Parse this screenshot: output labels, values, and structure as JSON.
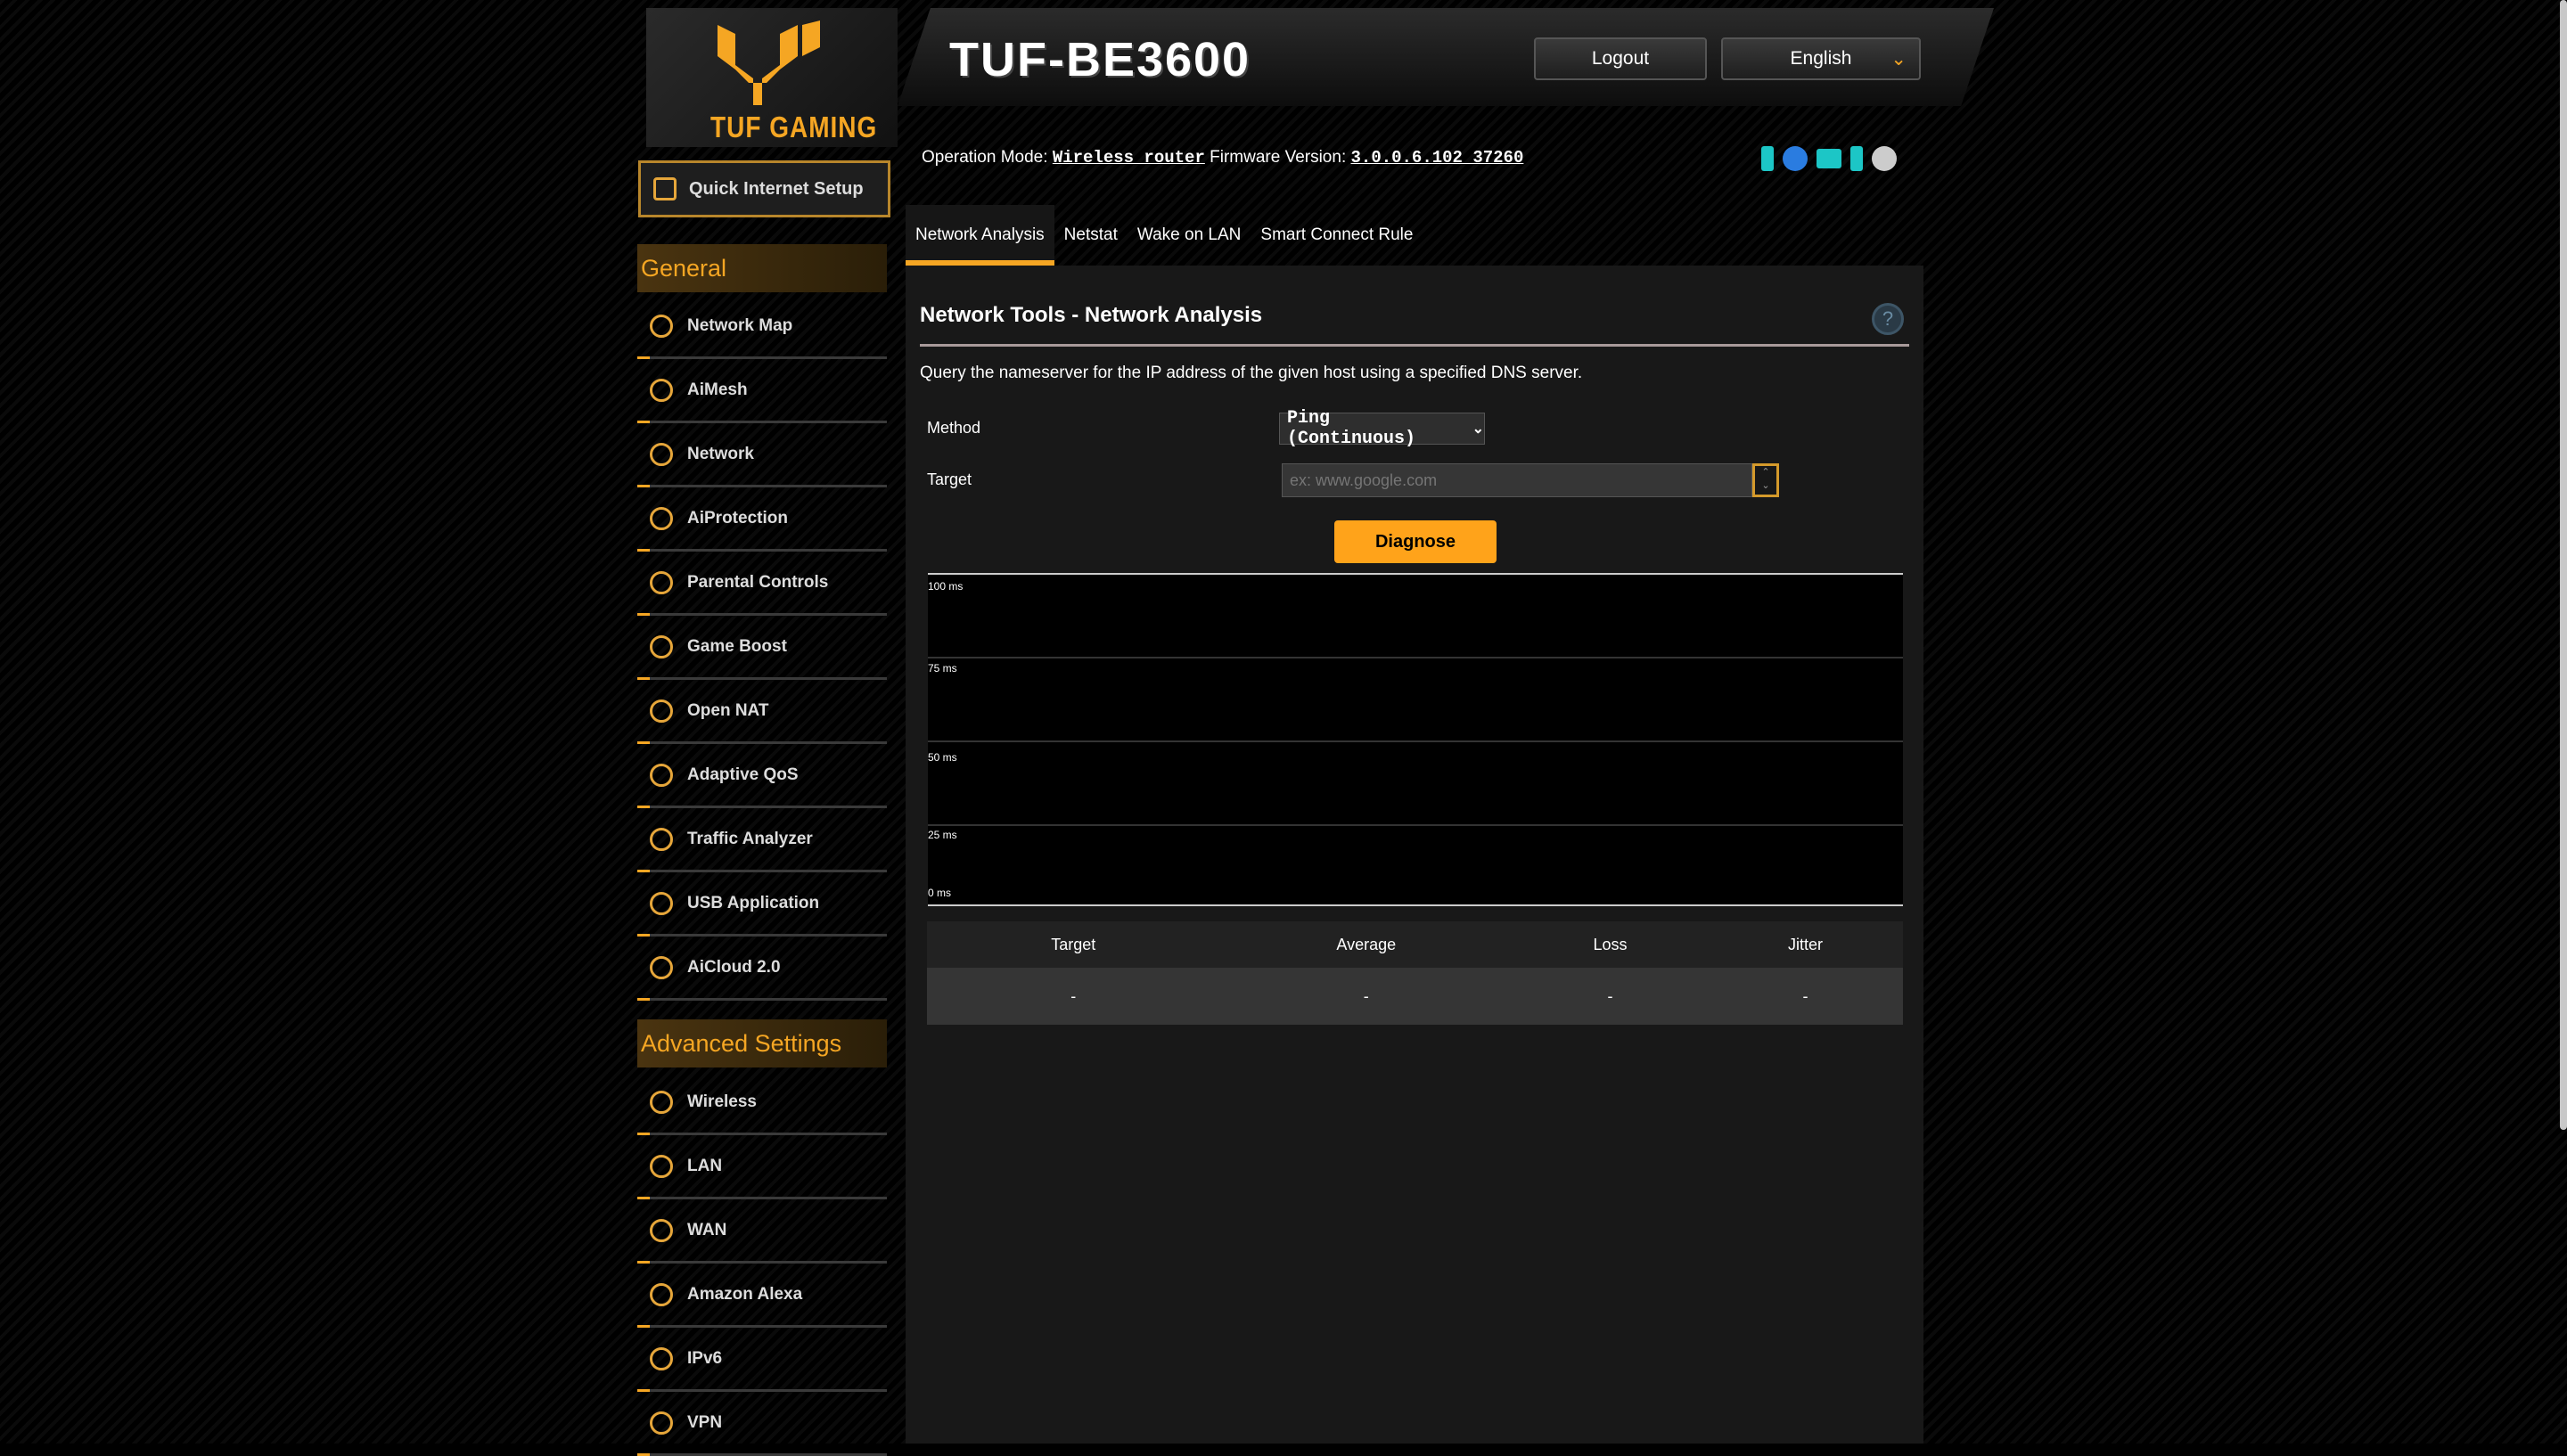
{
  "header": {
    "logo_text": "TUF GAMING",
    "model": "TUF-BE3600",
    "logout": "Logout",
    "language": "English",
    "op_mode_label": "Operation Mode:",
    "op_mode_value": "Wireless router",
    "fw_label": "Firmware Version:",
    "fw_value": "3.0.0.6.102_37260",
    "status_icons": [
      "usb-status-icon",
      "settings-gear-icon",
      "network-clients-icon",
      "usb-device-icon",
      "system-gear-icon"
    ]
  },
  "sidebar": {
    "quick_setup": "Quick Internet Setup",
    "general_title": "General",
    "general": [
      "Network Map",
      "AiMesh",
      "Network",
      "AiProtection",
      "Parental Controls",
      "Game Boost",
      "Open NAT",
      "Adaptive QoS",
      "Traffic Analyzer",
      "USB Application",
      "AiCloud 2.0"
    ],
    "advanced_title": "Advanced Settings",
    "advanced": [
      "Wireless",
      "LAN",
      "WAN",
      "Amazon Alexa",
      "IPv6",
      "VPN"
    ]
  },
  "tabs": [
    "Network Analysis",
    "Netstat",
    "Wake on LAN",
    "Smart Connect Rule"
  ],
  "main": {
    "title": "Network Tools - Network Analysis",
    "help": "?",
    "description": "Query the nameserver for the IP address of the given host using a specified DNS server.",
    "method_label": "Method",
    "method_value": "Ping (Continuous)",
    "target_label": "Target",
    "target_placeholder": "ex: www.google.com",
    "diagnose": "Diagnose",
    "chart": {
      "y_ticks": [
        "100 ms",
        "75 ms",
        "50 ms",
        "25 ms",
        "0 ms"
      ]
    },
    "table": {
      "headers": [
        "Target",
        "Average",
        "Loss",
        "Jitter"
      ],
      "row": [
        "-",
        "-",
        "-",
        "-"
      ]
    }
  },
  "colors": {
    "accent": "#ffa31a",
    "bg": "#000000",
    "panel": "#1a1a1a"
  }
}
